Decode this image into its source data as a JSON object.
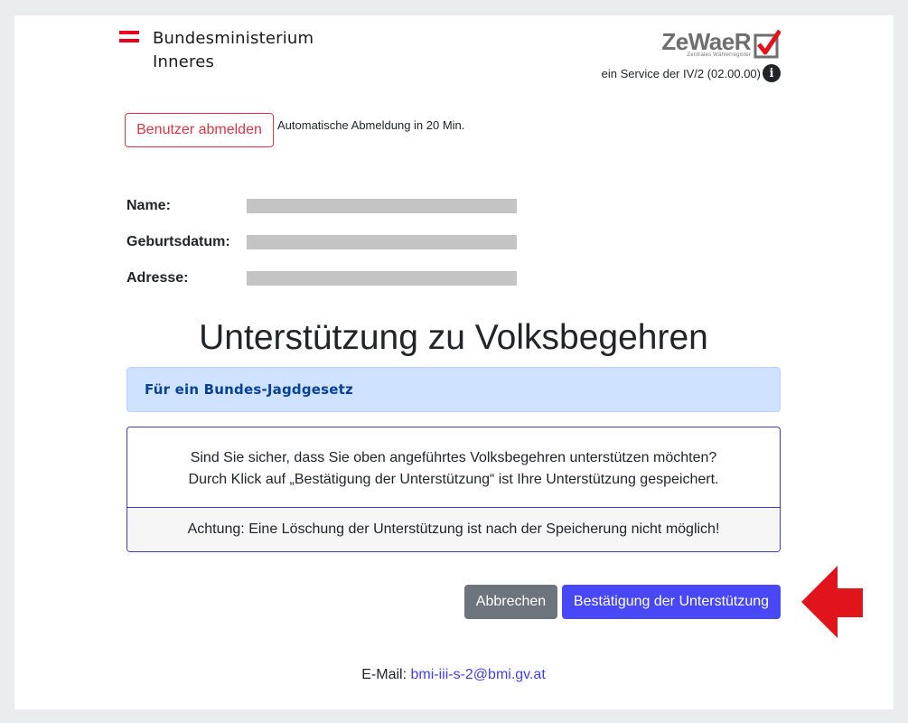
{
  "header": {
    "ministry_line1": "Bundesministerium",
    "ministry_line2": "Inneres",
    "logo_name": "ZeWaeR",
    "logo_subtitle": "Zentrales Wählerregister",
    "service_text": "ein Service der IV/2 (02.00.00)"
  },
  "session": {
    "logout_label": "Benutzer abmelden",
    "auto_logout_text": "Automatische Abmeldung in 20 Min."
  },
  "person": {
    "name_label": "Name:",
    "birthdate_label": "Geburtsdatum:",
    "address_label": "Adresse:"
  },
  "page_title": "Unterstützung zu Volksbegehren",
  "petition_name": "Für ein Bundes-Jagdgesetz",
  "confirmation": {
    "line1": "Sind Sie sicher, dass Sie oben angeführtes Volksbegehren unterstützen möchten?",
    "line2": "Durch Klick auf „Bestätigung der Unterstützung“ ist Ihre Unterstützung gespeichert.",
    "warning": "Achtung: Eine Löschung der Unterstützung ist nach der Speicherung nicht möglich!"
  },
  "actions": {
    "cancel_label": "Abbrechen",
    "confirm_label": "Bestätigung der Unterstützung"
  },
  "footer": {
    "email_label": "E-Mail:",
    "email_address": "bmi-iii-s-2@bmi.gv.at"
  },
  "colors": {
    "flag_red": "#e6001e",
    "logout_red": "#dc3545",
    "alert_bg": "#cfe2ff",
    "card_border": "#3d3dc9",
    "confirm_blue": "#4848f7",
    "cancel_gray": "#6c757d",
    "arrow_red": "#e1141b"
  },
  "icons": {
    "info": "info-icon",
    "checkmark": "check-icon",
    "arrow": "arrow-left-icon"
  }
}
